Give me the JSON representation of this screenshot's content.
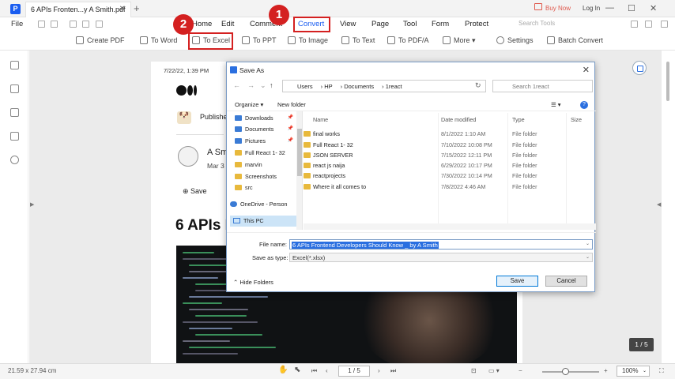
{
  "app": {
    "tab_title": "6 APIs Fronten...y A Smith.pdf",
    "tab_close": "✕",
    "new_tab": "+",
    "buy_now": "Buy Now",
    "log_in": "Log In",
    "win_min": "—",
    "win_max": "☐",
    "win_close": "✕"
  },
  "menu": {
    "file": "File",
    "items": [
      "Home",
      "Edit",
      "Comment",
      "Convert",
      "View",
      "Page",
      "Tool",
      "Form",
      "Protect"
    ],
    "search_placeholder": "Search Tools"
  },
  "toolbar": {
    "items": [
      "Create PDF",
      "To Word",
      "To Excel",
      "To PPT",
      "To Image",
      "To Text",
      "To PDF/A",
      "More",
      "Settings",
      "Batch Convert"
    ]
  },
  "callouts": {
    "convert_number": "1",
    "excel_number": "2"
  },
  "article": {
    "date": "7/22/22, 1:39 PM",
    "publish": "Publishe",
    "author": "A Smi",
    "author_date": "Mar 3",
    "save": "Save",
    "title": "6 APIs F"
  },
  "dialog": {
    "title": "Save As",
    "path": [
      "Users",
      "HP",
      "Documents",
      "1react"
    ],
    "search_placeholder": "Search 1react",
    "organize": "Organize ▾",
    "new_folder": "New folder",
    "help": "?",
    "nav_items": [
      {
        "label": "Downloads",
        "kind": "blue",
        "pinned": true
      },
      {
        "label": "Documents",
        "kind": "blue",
        "pinned": true
      },
      {
        "label": "Pictures",
        "kind": "blue",
        "pinned": true
      },
      {
        "label": "Full React 1- 32",
        "kind": "folder",
        "pinned": false
      },
      {
        "label": "marvin",
        "kind": "folder",
        "pinned": false
      },
      {
        "label": "Screenshots",
        "kind": "folder",
        "pinned": false
      },
      {
        "label": "src",
        "kind": "folder",
        "pinned": false
      },
      {
        "label": "OneDrive - Person",
        "kind": "cloud",
        "pinned": false
      },
      {
        "label": "This PC",
        "kind": "pc",
        "pinned": false,
        "selected": true
      }
    ],
    "columns": [
      "Name",
      "Date modified",
      "Type",
      "Size"
    ],
    "files": [
      {
        "name": "final works",
        "date": "8/1/2022 1:10 AM",
        "type": "File folder"
      },
      {
        "name": "Full React 1- 32",
        "date": "7/10/2022 10:08 PM",
        "type": "File folder"
      },
      {
        "name": "JSON SERVER",
        "date": "7/15/2022 12:11 PM",
        "type": "File folder"
      },
      {
        "name": "react js naija",
        "date": "6/29/2022 10:17 PM",
        "type": "File folder"
      },
      {
        "name": "reactprojects",
        "date": "7/30/2022 10:14 PM",
        "type": "File folder"
      },
      {
        "name": "Where it all comes to",
        "date": "7/8/2022 4:46 AM",
        "type": "File folder"
      }
    ],
    "file_name_label": "File name:",
    "file_name": "6 APIs Frontend Developers Should Know _ by A Smith",
    "save_type_label": "Save as type:",
    "save_type": "Excel(*.xlsx)",
    "hide_folders": "Hide Folders",
    "save_btn": "Save",
    "cancel_btn": "Cancel"
  },
  "status": {
    "dimensions": "21.59 x 27.94 cm",
    "page": "1 / 5",
    "zoom": "100%",
    "page_indicator": "1 / 5",
    "zoom_slider_fraction": 0.4
  }
}
